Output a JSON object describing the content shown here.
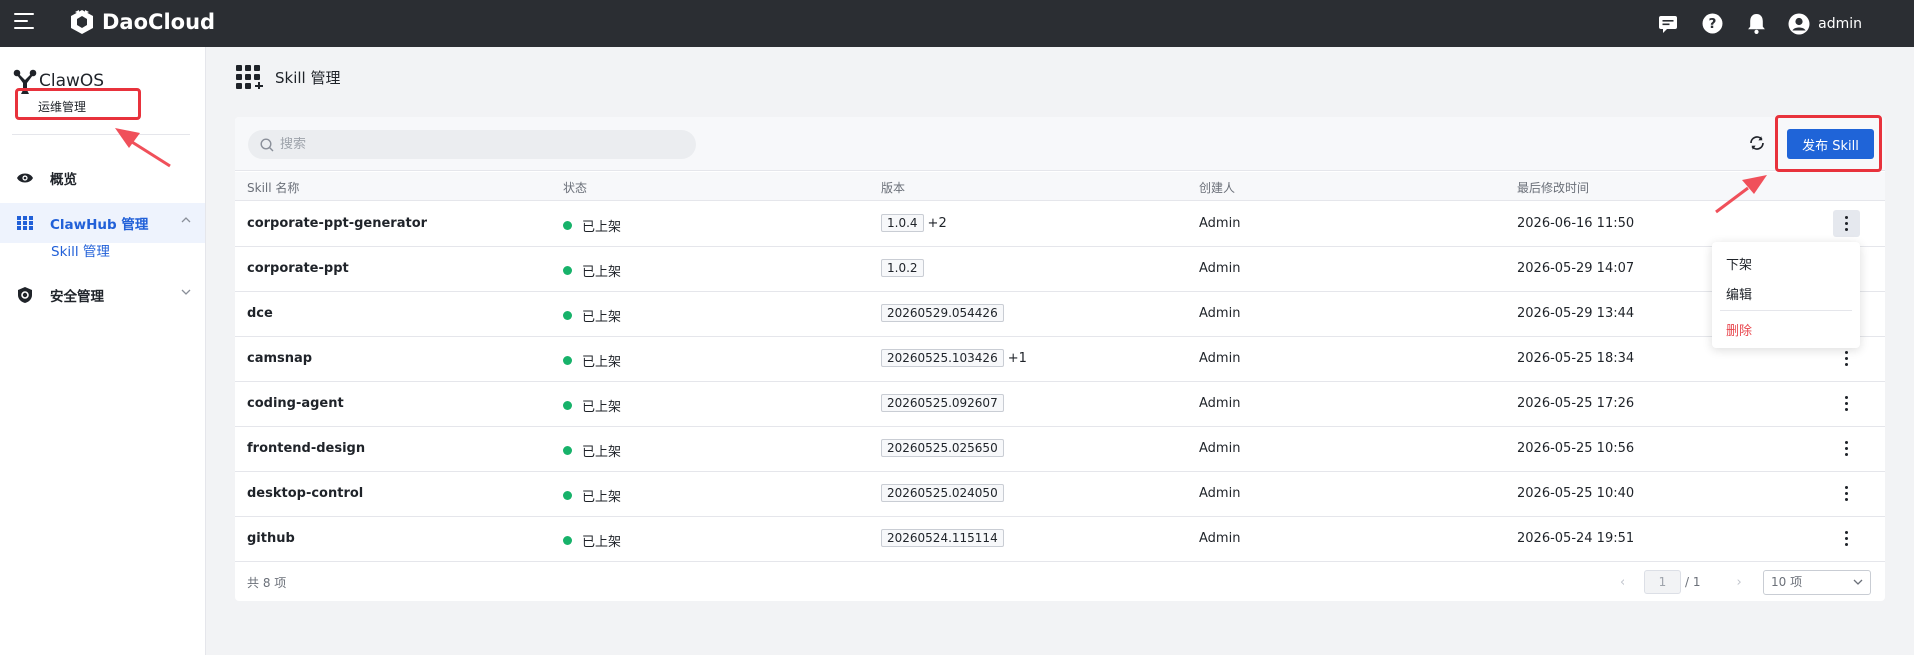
{
  "topbar": {
    "brand": "DaoCloud",
    "user": "admin",
    "icons": [
      "menu-icon",
      "message-icon",
      "help-icon",
      "bell-icon",
      "user-avatar-icon"
    ]
  },
  "sidebar": {
    "app_title": "ClawOS",
    "app_subtitle": "运维管理",
    "items": [
      {
        "label": "概览",
        "icon": "eye-icon"
      },
      {
        "label": "ClawHub 管理",
        "icon": "grid-icon"
      },
      {
        "label": "安全管理",
        "icon": "shield-icon"
      }
    ],
    "sub_items": [
      {
        "label": "Skill 管理"
      }
    ]
  },
  "page": {
    "title": "Skill 管理"
  },
  "toolbar": {
    "search_placeholder": "搜索",
    "publish_label": "发布 Skill"
  },
  "table": {
    "columns": [
      "Skill 名称",
      "状态",
      "版本",
      "创建人",
      "最后修改时间"
    ],
    "rows": [
      {
        "name": "corporate-ppt-generator",
        "status": "已上架",
        "version": "1.0.4",
        "extra": "+2",
        "creator": "Admin",
        "modified": "2026-06-16 11:50"
      },
      {
        "name": "corporate-ppt",
        "status": "已上架",
        "version": "1.0.2",
        "extra": "",
        "creator": "Admin",
        "modified": "2026-05-29 14:07"
      },
      {
        "name": "dce",
        "status": "已上架",
        "version": "20260529.054426",
        "extra": "",
        "creator": "Admin",
        "modified": "2026-05-29 13:44"
      },
      {
        "name": "camsnap",
        "status": "已上架",
        "version": "20260525.103426",
        "extra": "+1",
        "creator": "Admin",
        "modified": "2026-05-25 18:34"
      },
      {
        "name": "coding-agent",
        "status": "已上架",
        "version": "20260525.092607",
        "extra": "",
        "creator": "Admin",
        "modified": "2026-05-25 17:26"
      },
      {
        "name": "frontend-design",
        "status": "已上架",
        "version": "20260525.025650",
        "extra": "",
        "creator": "Admin",
        "modified": "2026-05-25 10:56"
      },
      {
        "name": "desktop-control",
        "status": "已上架",
        "version": "20260525.024050",
        "extra": "",
        "creator": "Admin",
        "modified": "2026-05-25 10:40"
      },
      {
        "name": "github",
        "status": "已上架",
        "version": "20260524.115114",
        "extra": "",
        "creator": "Admin",
        "modified": "2026-05-24 19:51"
      }
    ]
  },
  "dropdown": {
    "items": [
      "下架",
      "编辑",
      "删除"
    ]
  },
  "pagination": {
    "total": "共 8 项",
    "current": "1",
    "pages": "/ 1",
    "page_size": "10 项"
  },
  "colors": {
    "accent": "#1f64d8",
    "status_ok": "#17b26a",
    "highlight": "#e8323c",
    "danger": "#e8474e"
  }
}
